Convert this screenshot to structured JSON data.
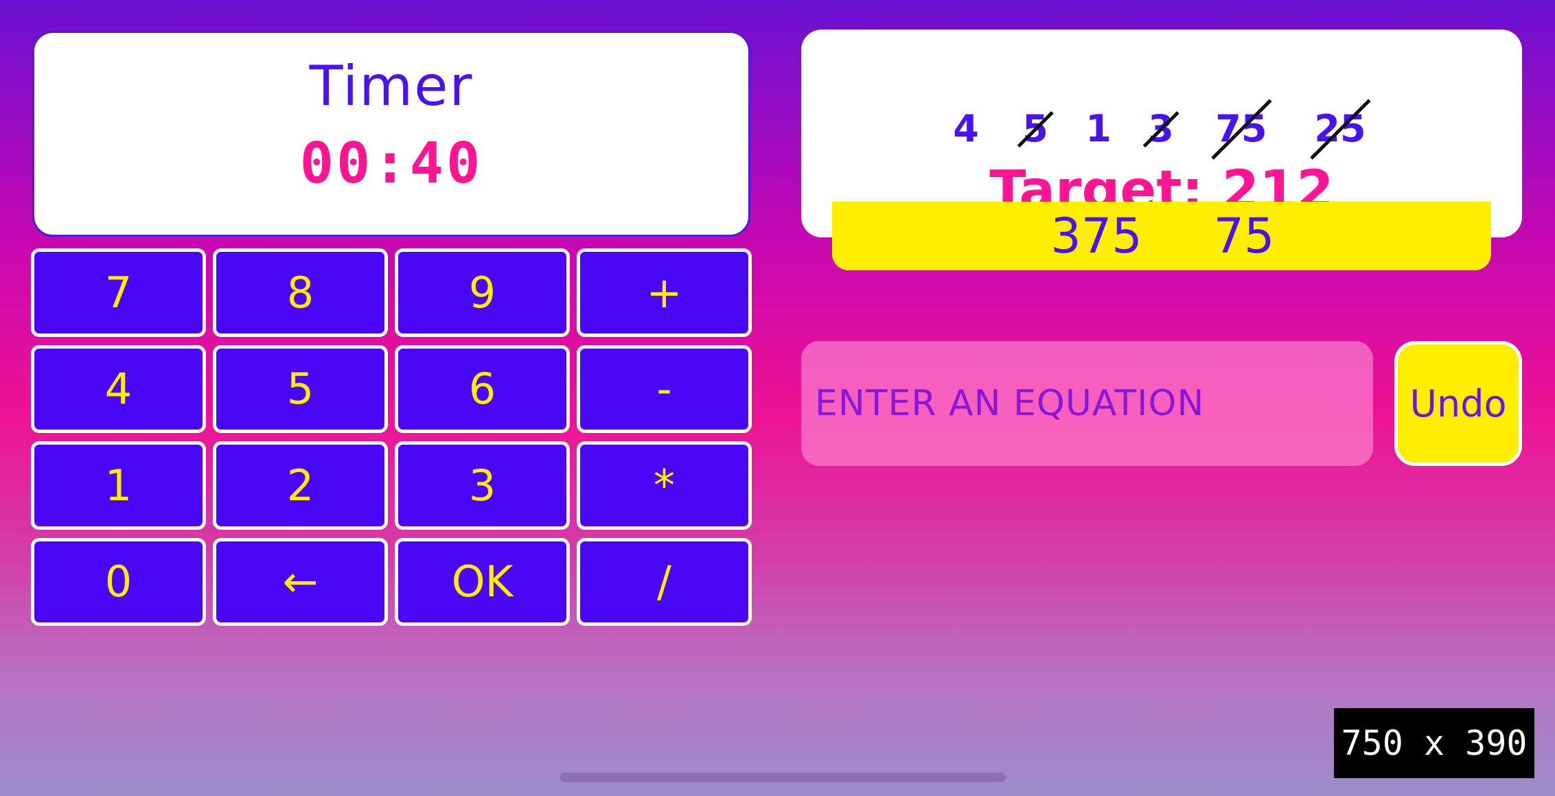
{
  "timer": {
    "title": "Timer",
    "value": "00:40"
  },
  "keypad": {
    "keys": [
      "7",
      "8",
      "9",
      "+",
      "4",
      "5",
      "6",
      "-",
      "1",
      "2",
      "3",
      "*",
      "0",
      "←",
      "OK",
      "/"
    ]
  },
  "numbers": [
    {
      "value": "4",
      "used": false
    },
    {
      "value": "5",
      "used": true
    },
    {
      "value": "1",
      "used": false
    },
    {
      "value": "3",
      "used": true
    },
    {
      "value": "75",
      "used": true
    },
    {
      "value": "25",
      "used": true
    }
  ],
  "target": {
    "label": "Target: 212"
  },
  "results": [
    "375",
    "75"
  ],
  "equation": {
    "placeholder": "ENTER AN EQUATION",
    "value": ""
  },
  "undo": {
    "label": "Undo"
  },
  "size_badge": {
    "label": "750 x 390"
  },
  "colors": {
    "accent_purple": "#4a07f5",
    "accent_pink": "#ff1493",
    "accent_yellow": "#ffee00",
    "panel_white": "#ffffff"
  }
}
